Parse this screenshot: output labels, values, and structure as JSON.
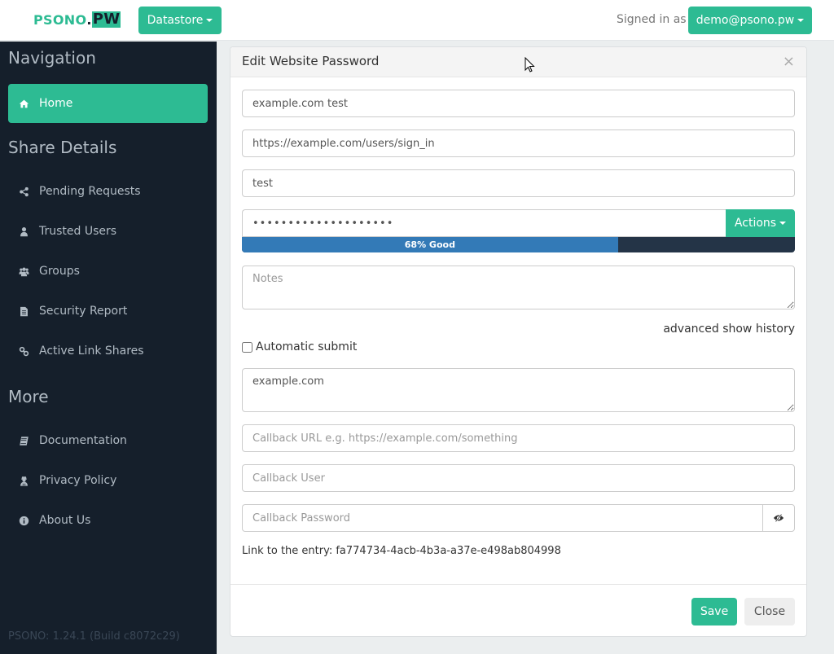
{
  "header": {
    "logo_text": "PSONO",
    "logo_dot": ".",
    "logo_suffix": "PW",
    "datastore_label": "Datastore",
    "signed_in_label": "Signed in as",
    "user_label": "demo@psono.pw"
  },
  "sidebar": {
    "navigation_heading": "Navigation",
    "navigation_items": [
      {
        "label": "Home",
        "icon": "home-icon",
        "active": true
      }
    ],
    "share_heading": "Share Details",
    "share_items": [
      {
        "label": "Pending Requests",
        "icon": "share-icon"
      },
      {
        "label": "Trusted Users",
        "icon": "user-icon"
      },
      {
        "label": "Groups",
        "icon": "users-icon"
      },
      {
        "label": "Security Report",
        "icon": "file-text-icon"
      },
      {
        "label": "Active Link Shares",
        "icon": "link-icon"
      }
    ],
    "more_heading": "More",
    "more_items": [
      {
        "label": "Documentation",
        "icon": "book-icon"
      },
      {
        "label": "Privacy Policy",
        "icon": "user-secret-icon"
      },
      {
        "label": "About Us",
        "icon": "info-circle-icon"
      }
    ],
    "version": "PSONO: 1.24.1 (Build c8072c29)"
  },
  "modal": {
    "title": "Edit Website Password",
    "close_symbol": "×",
    "fields": {
      "title_value": "example.com test",
      "url_value": "https://example.com/users/sign_in",
      "username_value": "test",
      "password_masked": "••••••••••••••••••••",
      "actions_label": "Actions",
      "strength": {
        "percent": 68,
        "label": "68% Good"
      },
      "notes_placeholder": "Notes",
      "notes_value": "",
      "advanced_label": "advanced",
      "show_history_label": "show history",
      "auto_submit_label": "Automatic submit",
      "auto_submit_checked": false,
      "url_filter_value": "example.com",
      "callback_url_placeholder": "Callback URL e.g. https://example.com/something",
      "callback_user_placeholder": "Callback User",
      "callback_password_placeholder": "Callback Password"
    },
    "entry_link_text": "Link to the entry: fa774734-4acb-4b3a-a37e-e498ab804998",
    "save_label": "Save",
    "close_label": "Close"
  },
  "colors": {
    "accent": "#2dbb93",
    "sidebar_bg": "#151f2b",
    "progress_fill": "#337ab7",
    "progress_track": "#243447"
  }
}
